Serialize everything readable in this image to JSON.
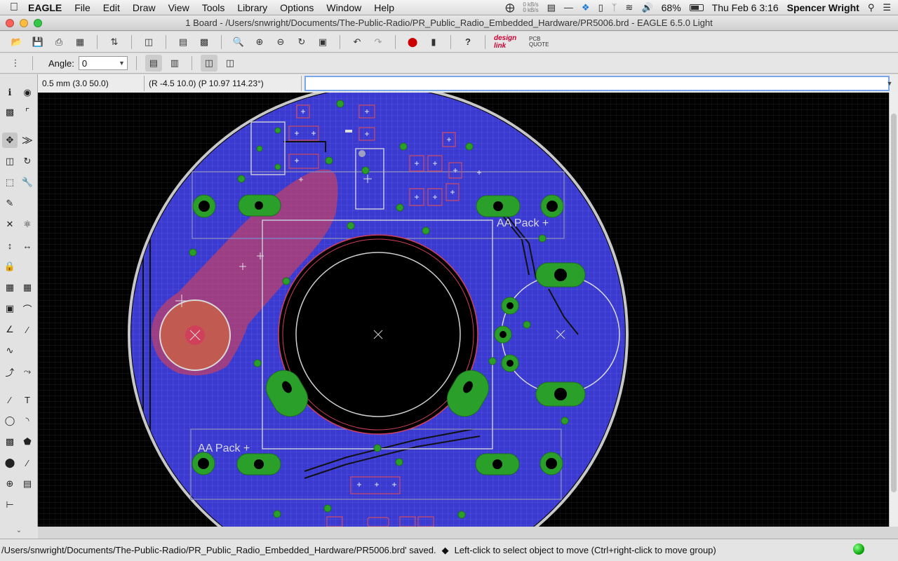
{
  "menubar": {
    "app": "EAGLE",
    "items": [
      "File",
      "Edit",
      "Draw",
      "View",
      "Tools",
      "Library",
      "Options",
      "Window",
      "Help"
    ],
    "net_up": "0 kB/s",
    "net_down": "0 kB/s",
    "battery": "68%",
    "clock": "Thu Feb 6  3:16",
    "user": "Spencer Wright"
  },
  "window": {
    "title": "1 Board - /Users/snwright/Documents/The-Public-Radio/PR_Public_Radio_Embedded_Hardware/PR5006.brd - EAGLE 6.5.0 Light"
  },
  "toolbar2": {
    "angle_label": "Angle:",
    "angle_value": "0"
  },
  "logos": {
    "designlink": "design link",
    "pcbquote": "PCB QUOTE"
  },
  "coords": {
    "grid": "0.5 mm (3.0 50.0)",
    "position": "(R -4.5 10.0) (P 10.97 114.23°)"
  },
  "command": {
    "value": ""
  },
  "board": {
    "labels": [
      "AA Pack +",
      "AA Pack +"
    ],
    "colors": {
      "background": "#000000",
      "copper_bottom": "#3a3ad0",
      "copper_top": "#d0405a",
      "pad": "#2aa02a",
      "outline": "#c8c8c8",
      "silk": "#d8d8d8"
    }
  },
  "status": {
    "message": "/Users/snwright/Documents/The-Public-Radio/PR_Public_Radio_Embedded_Hardware/PR5006.brd' saved.",
    "hint": "Left-click to select object to move (Ctrl+right-click to move group)"
  }
}
